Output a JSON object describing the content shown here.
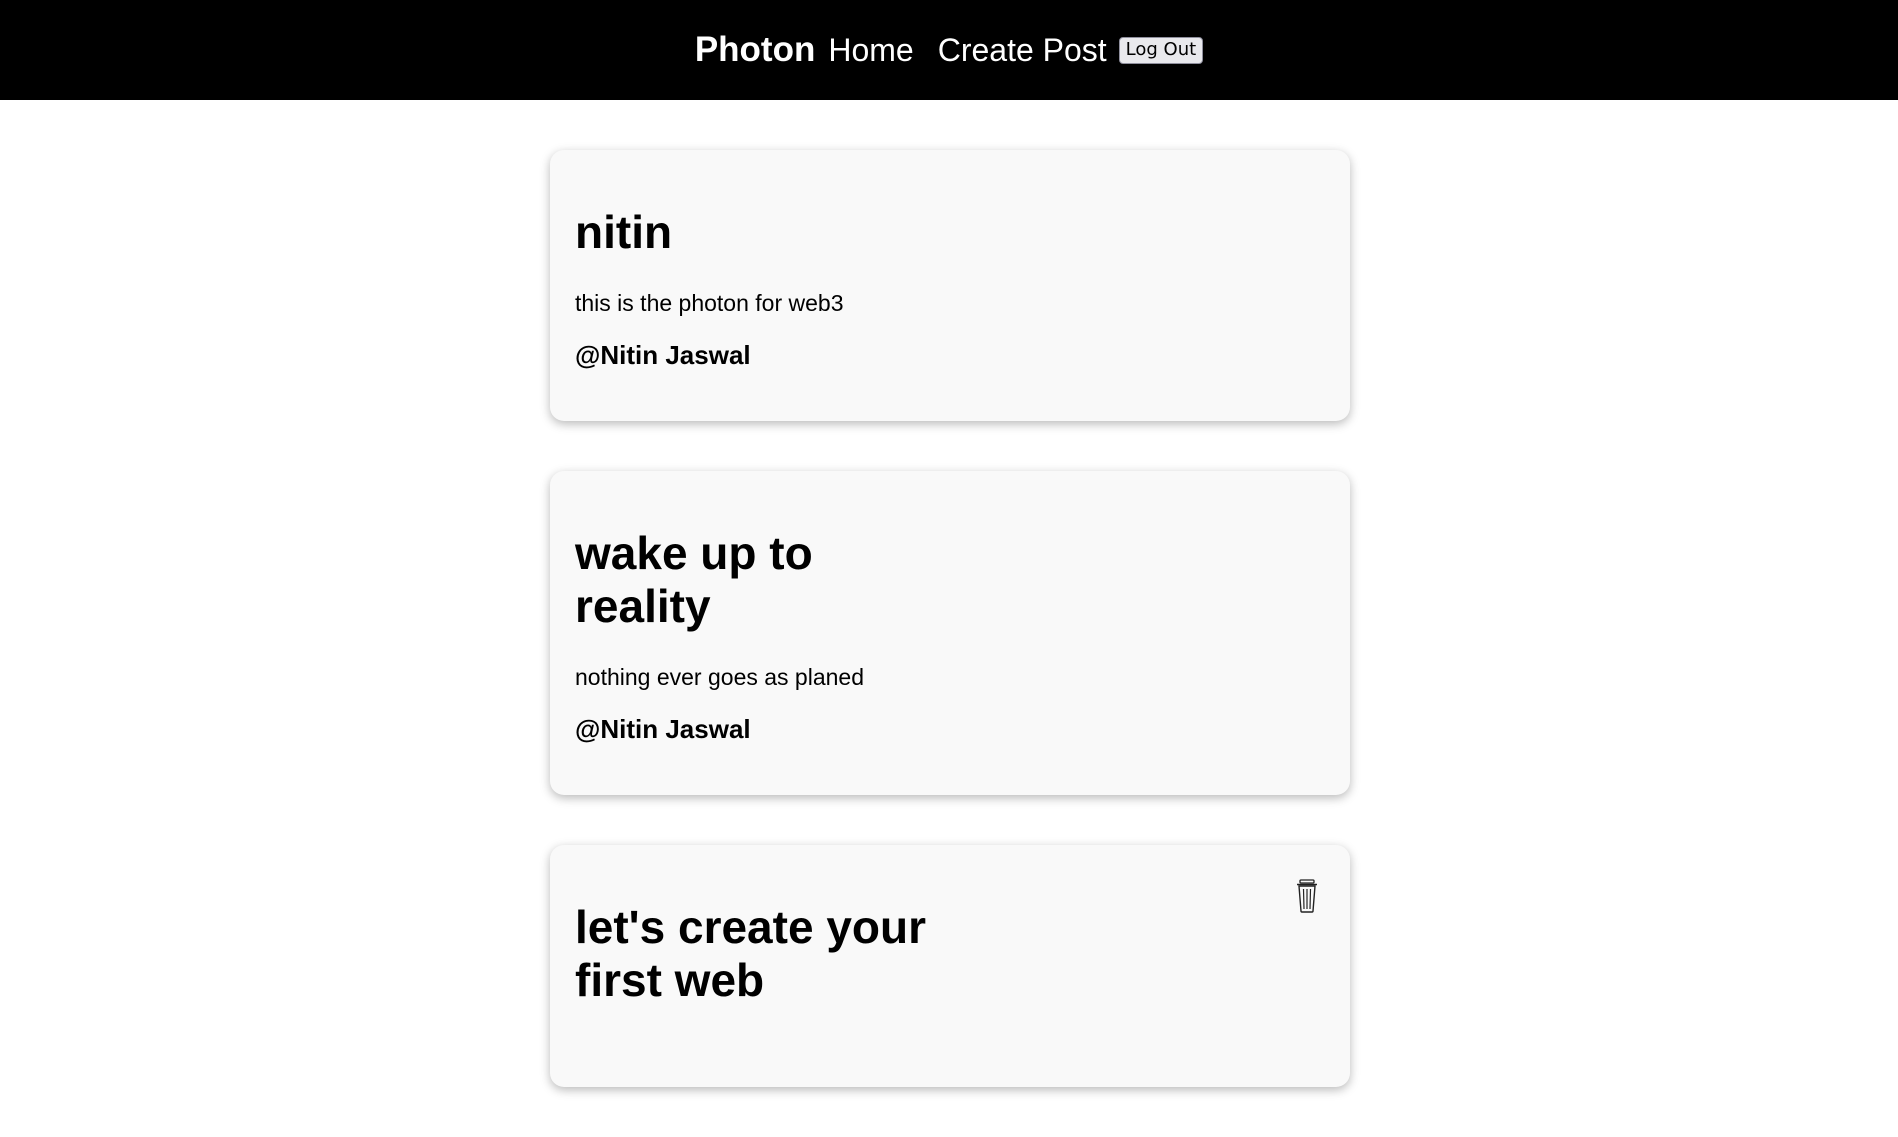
{
  "nav": {
    "brand": "Photon",
    "home_label": "Home",
    "create_post_label": "Create Post",
    "logout_label": "Log Out"
  },
  "posts": [
    {
      "title": "nitin",
      "body": "this is the photon for web3",
      "author": "@Nitin Jaswal",
      "has_delete": false
    },
    {
      "title": "wake up to reality",
      "body": "nothing ever goes as planed",
      "author": "@Nitin Jaswal",
      "has_delete": false
    },
    {
      "title": "let's create your first web",
      "body": "",
      "author": "",
      "has_delete": true,
      "delete_icon": "trash-icon"
    }
  ],
  "colors": {
    "navbar_bg": "#000000",
    "card_bg": "#f9f9f9",
    "page_bg": "#ffffff"
  }
}
